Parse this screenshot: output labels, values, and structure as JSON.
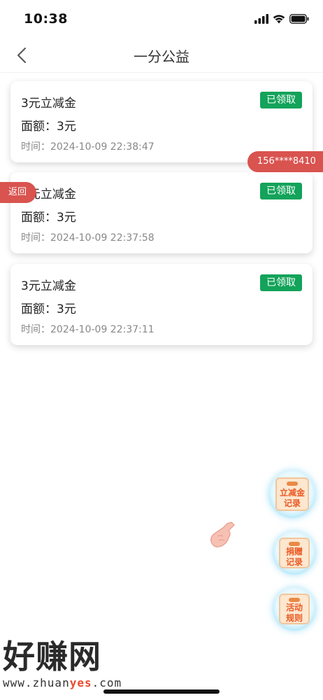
{
  "status_bar": {
    "time": "10:38"
  },
  "nav": {
    "title": "一分公益"
  },
  "records": [
    {
      "title": "3元立减金",
      "amount": "面额：3元",
      "time": "时间：2024-10-09 22:38:47",
      "status": "已领取"
    },
    {
      "title": "3元立减金",
      "amount": "面额：3元",
      "time": "时间：2024-10-09 22:37:58",
      "status": "已领取"
    },
    {
      "title": "3元立减金",
      "amount": "面额：3元",
      "time": "时间：2024-10-09 22:37:11",
      "status": "已领取"
    }
  ],
  "overlays": {
    "phone": "156****8410",
    "return": "返回"
  },
  "floating_buttons": [
    {
      "line1": "立减金",
      "line2": "记录"
    },
    {
      "line1": "捐赠",
      "line2": "记录"
    },
    {
      "line1": "活动",
      "line2": "规则"
    }
  ],
  "watermark": {
    "main": "好赚网",
    "url_a": "www.zhuan",
    "url_b": "yes",
    "url_c": ".com"
  },
  "colors": {
    "badge_green": "#13a35a",
    "tag_red": "#d9534f",
    "accent_orange": "#ea5a25"
  }
}
